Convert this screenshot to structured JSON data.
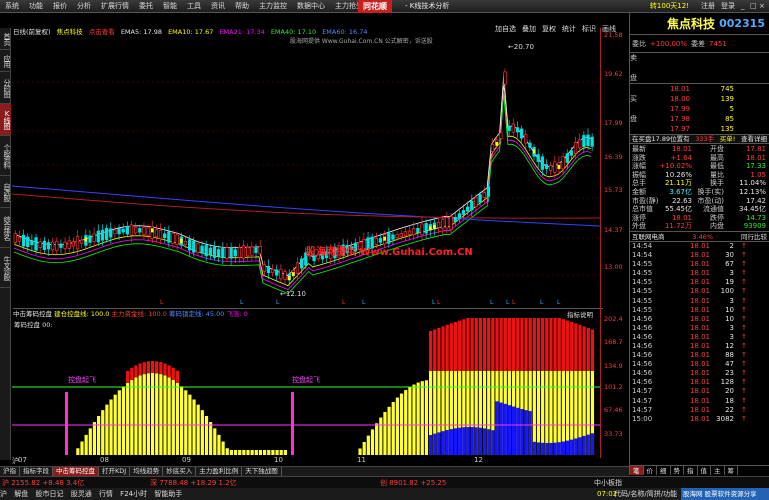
{
  "menu": [
    "系统",
    "功能",
    "报价",
    "分析",
    "扩展行情",
    "委托",
    "智能",
    "工具",
    "资讯",
    "帮助"
  ],
  "menu_right": [
    "主力监控",
    "数据中心",
    "主力抢先",
    "问财"
  ],
  "logo": "同花顺",
  "app_title": "- K线技术分析",
  "login_text": "转100天12!",
  "menu_right_links": [
    "注册",
    "登录"
  ],
  "window_buttons": [
    "_",
    "□",
    "×"
  ],
  "left_tabs": [
    {
      "label": "首页",
      "active": false
    },
    {
      "label": "应用",
      "active": false
    },
    {
      "label": "分时图",
      "active": false
    },
    {
      "label": "K线图",
      "active": true
    },
    {
      "label": "个股资料",
      "active": false
    },
    {
      "label": "自选股",
      "active": false
    },
    {
      "label": "综合排名",
      "active": false
    },
    {
      "label": "牛叉诊股",
      "active": false
    }
  ],
  "chart_header": {
    "period": "日线(前复权)",
    "name": "焦点科技",
    "hint": "点击查看",
    "ma5": "EMA5: 17.98",
    "ma10": "EMA10: 17.67",
    "ma21": "EMA21: 17.34",
    "ma40": "EMA40: 17.10",
    "ma60": "EMA60: 16.74",
    "sub": "股海网提供 Www.Guhai.Com.CN 公式解密，诉送股"
  },
  "chart_tools": [
    "加自选",
    "叠加",
    "复权",
    "统计",
    "标识",
    "画线"
  ],
  "watermark": "股海网提供 Www.Guhai.Com.CN",
  "annotations": {
    "high": "20.70",
    "low": "12.10"
  },
  "price_axis": [
    "21.58",
    "19.62",
    "17.99",
    "16.39",
    "15.73",
    "14.37",
    "13.00",
    "202.4",
    "168.7",
    "134.9",
    "101.2",
    "67.46",
    "33.73"
  ],
  "indicator_header": {
    "label": "中击筹码控盘",
    "a": "建仓控盘线: 100.0",
    "b": "主力资金线: 100.0",
    "c": "筹码锁定线: 45.00",
    "d": "飞涨: 0"
  },
  "indicator_title": "筹码控盘 00:",
  "indicator_help": "指标说明",
  "indicator_annots": [
    "控盘起飞",
    "控盘起飞"
  ],
  "x_axis": [
    "沪",
    "07",
    "08",
    "09",
    "10",
    "11",
    "12",
    "08",
    "13"
  ],
  "bottom_tabs": [
    {
      "label": "沪指",
      "active": false
    },
    {
      "label": "指标字段",
      "active": false
    },
    {
      "label": "中击筹码控盘",
      "active": true
    },
    {
      "label": "打开KDJ",
      "active": false
    },
    {
      "label": "均线趋势",
      "active": false
    },
    {
      "label": "妙底买入",
      "active": false
    },
    {
      "label": "主力盈利比例",
      "active": false
    },
    {
      "label": "天下独战图",
      "active": false
    }
  ],
  "status": {
    "sh": "沪 2155.82 +8.48 3.4亿",
    "sz": "深 7788.48 +18.29 1.2亿",
    "cy": "创 8901.82 +25.25",
    "zx": "中小板指"
  },
  "footer_items": [
    "沪",
    "解盘",
    "股市日记",
    "股灵通",
    "行情",
    "F24小时",
    "智能助手"
  ],
  "footer_time": "07:02",
  "footer_right": "代码/名称/简拼/功能",
  "guhai_banner": "股海网 股票软件资源分享",
  "stock": {
    "name": "焦点科技",
    "code": "002315"
  },
  "weibi": {
    "label": "委比",
    "value": "+100.00%",
    "diff_label": "委差",
    "diff": "7451"
  },
  "asks": [
    {
      "label": "卖",
      "price": "",
      "vol": ""
    },
    {
      "label": "",
      "price": "",
      "vol": ""
    },
    {
      "label": "盘",
      "price": "",
      "vol": ""
    }
  ],
  "bids": [
    {
      "label": "",
      "price": "18.01",
      "vol": "745"
    },
    {
      "label": "买",
      "price": "18.00",
      "vol": "139"
    },
    {
      "label": "",
      "price": "17.99",
      "vol": "5"
    },
    {
      "label": "盘",
      "price": "17.98",
      "vol": "85"
    },
    {
      "label": "",
      "price": "17.97",
      "vol": "135"
    }
  ],
  "mainbuy": {
    "a": "在买盘17.89位置有",
    "b": "333手",
    "c": "买单!",
    "d": "查看详细"
  },
  "stats": [
    {
      "l": "最新",
      "v": "18.01",
      "vc": "red",
      "l2": "开盘",
      "v2": "17.81",
      "v2c": "red"
    },
    {
      "l": "涨跌",
      "v": "+1.64",
      "vc": "red",
      "l2": "最高",
      "v2": "18.01",
      "v2c": "red"
    },
    {
      "l": "涨幅",
      "v": "+10.02%",
      "vc": "red",
      "l2": "最低",
      "v2": "17.33",
      "v2c": "green"
    },
    {
      "l": "振幅",
      "v": "10.26%",
      "vc": "white",
      "l2": "量比",
      "v2": "1.05",
      "v2c": "red"
    },
    {
      "l": "总手",
      "v": "21.11万",
      "vc": "yel",
      "l2": "换手",
      "v2": "11.04%",
      "v2c": "white"
    },
    {
      "l": "金额",
      "v": "3.67亿",
      "vc": "cyan",
      "l2": "换手(实)",
      "v2": "12.13%",
      "v2c": "white"
    },
    {
      "l": "市盈(静)",
      "v": "22.63",
      "vc": "white",
      "l2": "市盈(动)",
      "v2": "17.42",
      "v2c": "white"
    },
    {
      "l": "总市值",
      "v": "55.45亿",
      "vc": "white",
      "l2": "流通值",
      "v2": "34.45亿",
      "v2c": "white"
    },
    {
      "l": "涨停",
      "v": "18.01",
      "vc": "red",
      "l2": "跌停",
      "v2": "14.73",
      "v2c": "green"
    },
    {
      "l": "外盘",
      "v": "11.72万",
      "vc": "red",
      "l2": "内盘",
      "v2": "93909",
      "v2c": "green"
    }
  ],
  "trade_head": {
    "a": "互联网电商",
    "b": "3.46%",
    "c": "同行比较"
  },
  "trades": [
    {
      "t": "14:54",
      "p": "18.01",
      "v": "2",
      "d": "up"
    },
    {
      "t": "14:54",
      "p": "18.01",
      "v": "30",
      "d": "up"
    },
    {
      "t": "14:55",
      "p": "18.01",
      "v": "67",
      "d": "up"
    },
    {
      "t": "14:55",
      "p": "18.01",
      "v": "3",
      "d": "up"
    },
    {
      "t": "14:55",
      "p": "18.01",
      "v": "19",
      "d": "up"
    },
    {
      "t": "14:55",
      "p": "18.01",
      "v": "100",
      "d": "up"
    },
    {
      "t": "14:55",
      "p": "18.01",
      "v": "3",
      "d": "up"
    },
    {
      "t": "14:55",
      "p": "18.01",
      "v": "10",
      "d": "up"
    },
    {
      "t": "14:56",
      "p": "18.01",
      "v": "10",
      "d": "up"
    },
    {
      "t": "14:56",
      "p": "18.01",
      "v": "3",
      "d": "up"
    },
    {
      "t": "14:56",
      "p": "18.01",
      "v": "3",
      "d": "up"
    },
    {
      "t": "14:56",
      "p": "18.01",
      "v": "12",
      "d": "up"
    },
    {
      "t": "14:56",
      "p": "18.01",
      "v": "88",
      "d": "up"
    },
    {
      "t": "14:56",
      "p": "18.01",
      "v": "47",
      "d": "up"
    },
    {
      "t": "14:56",
      "p": "18.01",
      "v": "23",
      "d": "up"
    },
    {
      "t": "14:56",
      "p": "18.01",
      "v": "128",
      "d": "up"
    },
    {
      "t": "14:57",
      "p": "18.01",
      "v": "20",
      "d": "up"
    },
    {
      "t": "14:57",
      "p": "18.01",
      "v": "18",
      "d": "up"
    },
    {
      "t": "14:57",
      "p": "18.01",
      "v": "22",
      "d": "up"
    },
    {
      "t": "15:00",
      "p": "18.01",
      "v": "3082",
      "d": "up"
    }
  ],
  "panel_tabs": [
    {
      "label": "笔",
      "active": true
    },
    {
      "label": "价",
      "active": false
    },
    {
      "label": "细",
      "active": false
    },
    {
      "label": "势",
      "active": false
    },
    {
      "label": "指",
      "active": false
    },
    {
      "label": "值",
      "active": false
    },
    {
      "label": "主",
      "active": false
    },
    {
      "label": "筹",
      "active": false
    }
  ]
}
